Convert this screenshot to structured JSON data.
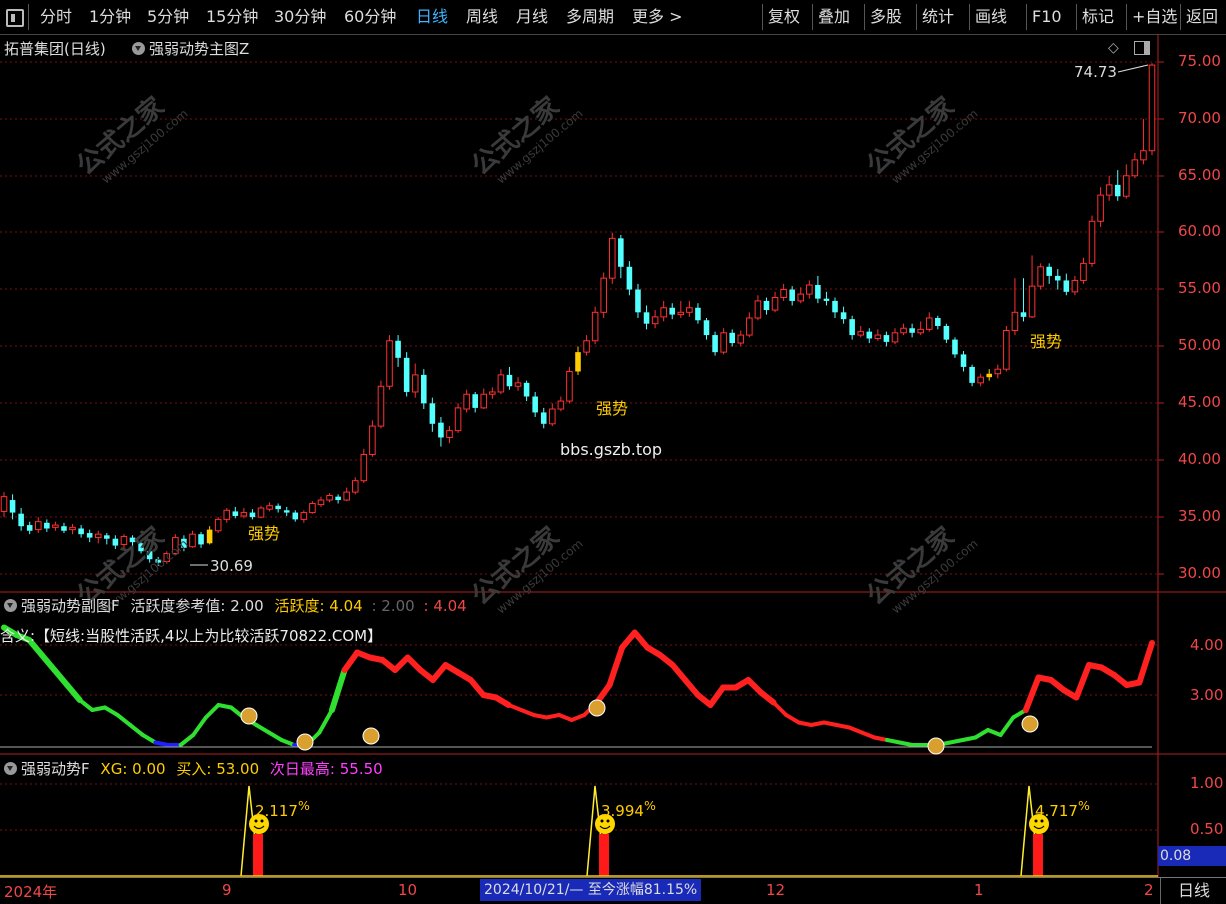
{
  "toolbar": {
    "items": [
      "分时",
      "1分钟",
      "5分钟",
      "15分钟",
      "30分钟",
      "60分钟",
      "日线",
      "周线",
      "月线",
      "多周期",
      "更多 >"
    ],
    "right_items": [
      "复权",
      "叠加",
      "多股",
      "统计",
      "画线",
      "F10",
      "标记",
      "+自选",
      "返回"
    ]
  },
  "main": {
    "stock_title": "拓普集团(日线)",
    "indicator_title": "强弱动势主图Z",
    "high_marker": "74.73",
    "low_marker": "30.69",
    "signal_label": "强势",
    "watermark_site": "bbs.gszb.top",
    "watermark_text": "公式之家",
    "watermark_url": "www.gszj100.com",
    "y_ticks": [
      "75.00",
      "70.00",
      "65.00",
      "60.00",
      "55.00",
      "50.00",
      "45.00",
      "40.00",
      "35.00",
      "30.00"
    ]
  },
  "sub1": {
    "title": "强弱动势副图F",
    "ref_label": "活跃度参考值:",
    "ref_value": "2.00",
    "act_label": "活跃度:",
    "act_value": "4.04",
    "extra_1": ": 2.00",
    "extra_2": ": 4.04",
    "note": "含义:【短线:当股性活跃,4以上为比较活跃70822.COM】",
    "y_ticks": [
      "4.00",
      "3.00"
    ]
  },
  "sub2": {
    "title": "强弱动势F",
    "xg_label": "XG:",
    "xg_value": "0.00",
    "buy_label": "买入:",
    "buy_value": "53.00",
    "next_label": "次日最高:",
    "next_value": "55.50",
    "pct_1": "2.117",
    "pct_2": "3.994",
    "pct_3": "4.717",
    "pct_sign": "%",
    "y_ticks": [
      "1.00",
      "0.50"
    ],
    "current_value": "0.08"
  },
  "bottom": {
    "x_labels": [
      "2024年",
      "9",
      "10",
      "12",
      "1",
      "2"
    ],
    "range_label": "2024/10/21/— 至今涨幅81.15%",
    "period": "日线"
  },
  "colors": {
    "up": "#ff3030",
    "down": "#54ffff",
    "signal": "#ffcc00",
    "active_tab": "#3cb4ff"
  }
}
